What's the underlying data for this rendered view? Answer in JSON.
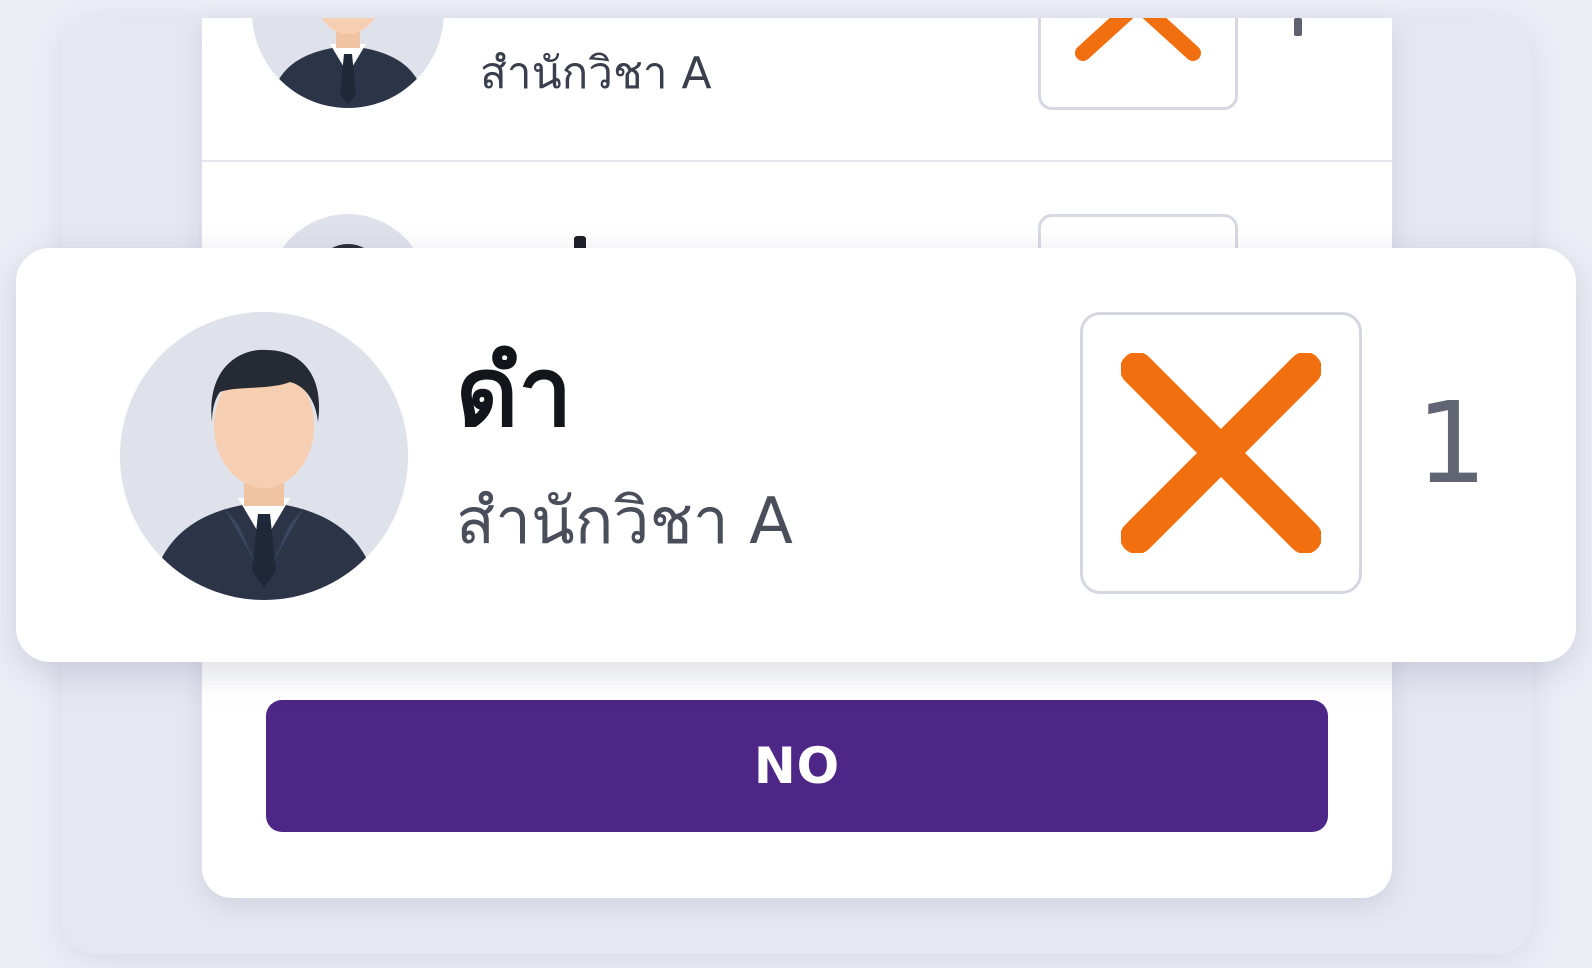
{
  "colors": {
    "accent_orange": "#f26f0f",
    "button_purple": "#4d2688",
    "background": "#eceef6",
    "card": "#ffffff"
  },
  "list": {
    "rows": [
      {
        "department": "สำนักวิชา A",
        "vote_icon": "check-icon",
        "count": ""
      },
      {
        "department": "",
        "vote_icon": "",
        "count": ""
      }
    ]
  },
  "selected_candidate": {
    "name": "ดำ",
    "department": "สำนักวิชา A",
    "vote_icon": "close-icon",
    "count": "1"
  },
  "actions": {
    "no_label": "NO"
  }
}
